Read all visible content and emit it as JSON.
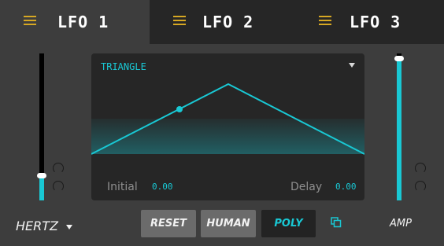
{
  "tabs": [
    {
      "label": "LFO 1",
      "active": true
    },
    {
      "label": "LFO 2",
      "active": false
    },
    {
      "label": "LFO 3",
      "active": false
    }
  ],
  "waveform": {
    "selected": "TRIANGLE"
  },
  "display": {
    "initial_label": "Initial",
    "initial_value": "0.00",
    "delay_label": "Delay",
    "delay_value": "0.00"
  },
  "rate_mode": {
    "selected": "HERTZ"
  },
  "buttons": {
    "reset": "RESET",
    "human": "HUMAN",
    "poly": "POLY"
  },
  "amp": {
    "label": "AMP"
  },
  "levels": {
    "rate_slider": 0.17,
    "amp_slider": 0.97
  },
  "colors": {
    "accent": "#19c8d4",
    "menu_icon": "#d7a823",
    "background": "#3d3d3d",
    "tab_inactive": "#262626"
  }
}
